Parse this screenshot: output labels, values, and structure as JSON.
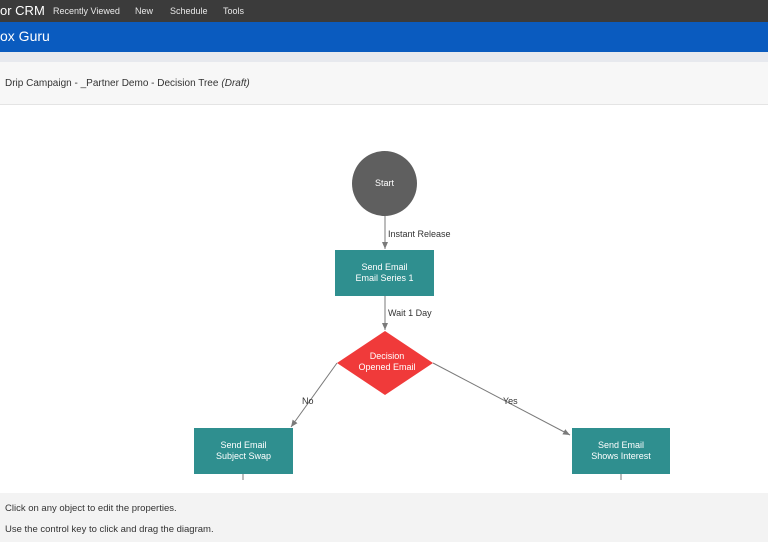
{
  "topnav": {
    "brand": "or CRM",
    "items": [
      "Recently Viewed",
      "New",
      "Schedule",
      "Tools"
    ]
  },
  "bluebar": {
    "title": "ox Guru"
  },
  "titlebar": {
    "campaign": "Drip Campaign - _Partner Demo - Decision Tree",
    "status": "(Draft)"
  },
  "diagram": {
    "start": "Start",
    "edge_instant": "Instant Release",
    "email1": {
      "line1": "Send Email",
      "line2": "Email Series 1"
    },
    "edge_wait": "Wait 1 Day",
    "decision": {
      "line1": "Decision",
      "line2": "Opened Email"
    },
    "edge_no": "No",
    "edge_yes": "Yes",
    "left_email": {
      "line1": "Send Email",
      "line2": "Subject Swap"
    },
    "right_email": {
      "line1": "Send Email",
      "line2": "Shows Interest"
    },
    "colors": {
      "start": "#5f5f5f",
      "email": "#2f8f8f",
      "decision": "#f03a3a",
      "connector": "#7a7a7a"
    }
  },
  "footer": {
    "help1": "Click on any object to edit the properties.",
    "help2": "Use the control key to click and drag the diagram."
  }
}
